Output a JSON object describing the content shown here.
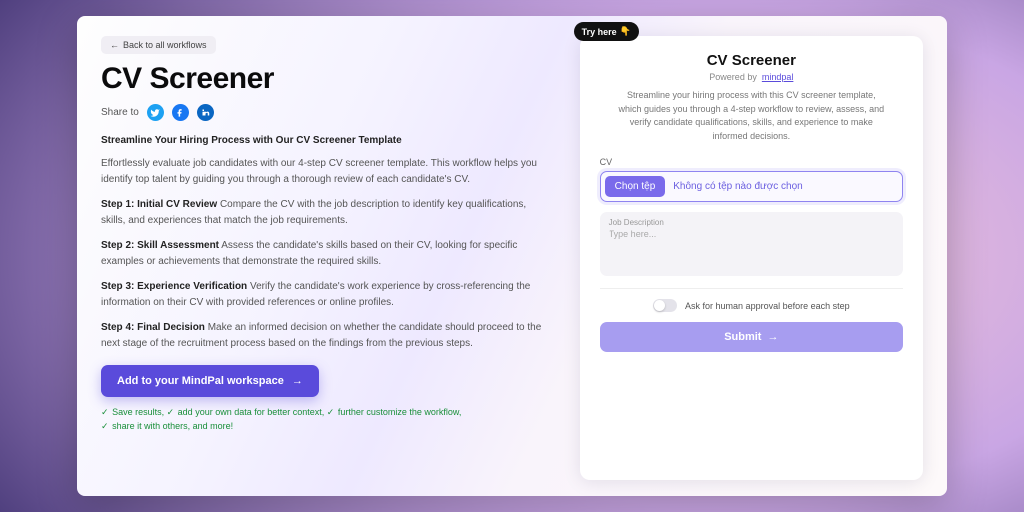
{
  "back_label": "Back to all workflows",
  "title": "CV Screener",
  "share_label": "Share to",
  "social": {
    "twitter": "twitter-icon",
    "facebook": "facebook-icon",
    "linkedin": "linkedin-icon"
  },
  "intro_bold": "Streamline Your Hiring Process with Our CV Screener Template",
  "intro_para": "Effortlessly evaluate job candidates with our 4-step CV screener template. This workflow helps you identify top talent by guiding you through a thorough review of each candidate's CV.",
  "steps": [
    {
      "head": "Step 1: Initial CV Review",
      "body": "Compare the CV with the job description to identify key qualifications, skills, and experiences that match the job requirements."
    },
    {
      "head": "Step 2: Skill Assessment",
      "body": "Assess the candidate's skills based on their CV, looking for specific examples or achievements that demonstrate the required skills."
    },
    {
      "head": "Step 3: Experience Verification",
      "body": "Verify the candidate's work experience by cross-referencing the information on their CV with provided references or online profiles."
    },
    {
      "head": "Step 4: Final Decision",
      "body": "Make an informed decision on whether the candidate should proceed to the next stage of the recruitment process based on the findings from the previous steps."
    }
  ],
  "cta_label": "Add to your MindPal workspace",
  "benefits": [
    "Save results,",
    "add your own data for better context,",
    "further customize the workflow,",
    "share it with others, and more!"
  ],
  "tryhere": "Try here",
  "widget": {
    "title": "CV Screener",
    "powered_prefix": "Powered by",
    "powered_link": "mindpal",
    "desc": "Streamline your hiring process with this CV screener template, which guides you through a 4-step workflow to review, assess, and verify candidate qualifications, skills, and experience to make informed decisions.",
    "cv_label": "CV",
    "file_button": "Chọn tệp",
    "file_status": "Không có tệp nào được chọn",
    "jd_label": "Job Description",
    "jd_placeholder": "Type here...",
    "approval_label": "Ask for human approval before each step",
    "submit_label": "Submit"
  }
}
